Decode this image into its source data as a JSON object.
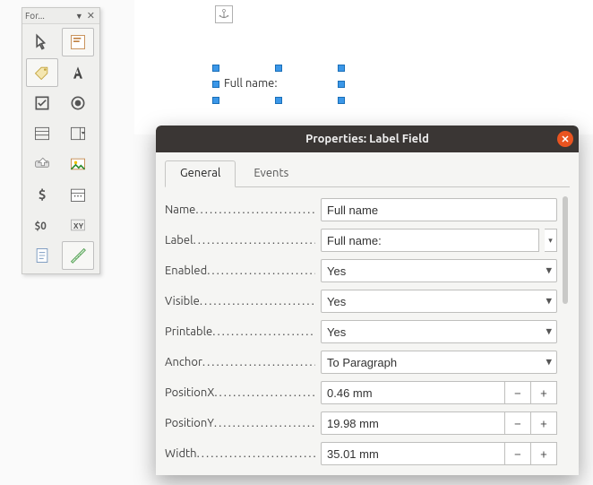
{
  "toolbox": {
    "title": "For..."
  },
  "canvas": {
    "selected_label_text": "Full name:"
  },
  "dialog": {
    "title": "Properties: Label Field",
    "tabs": {
      "general": "General",
      "events": "Events"
    },
    "rows": {
      "name": {
        "label": "Name",
        "value": "Full name"
      },
      "label": {
        "label": "Label",
        "value": "Full name:"
      },
      "enabled": {
        "label": "Enabled",
        "value": "Yes"
      },
      "visible": {
        "label": "Visible",
        "value": "Yes"
      },
      "printable": {
        "label": "Printable",
        "value": "Yes"
      },
      "anchor": {
        "label": "Anchor",
        "value": "To Paragraph"
      },
      "posx": {
        "label": "PositionX",
        "value": "0.46 mm"
      },
      "posy": {
        "label": "PositionY",
        "value": "19.98 mm"
      },
      "width": {
        "label": "Width",
        "value": "35.01 mm"
      }
    },
    "dots": "..............................................",
    "close": "✕",
    "chev": "▾",
    "minus": "−",
    "plus": "+"
  }
}
